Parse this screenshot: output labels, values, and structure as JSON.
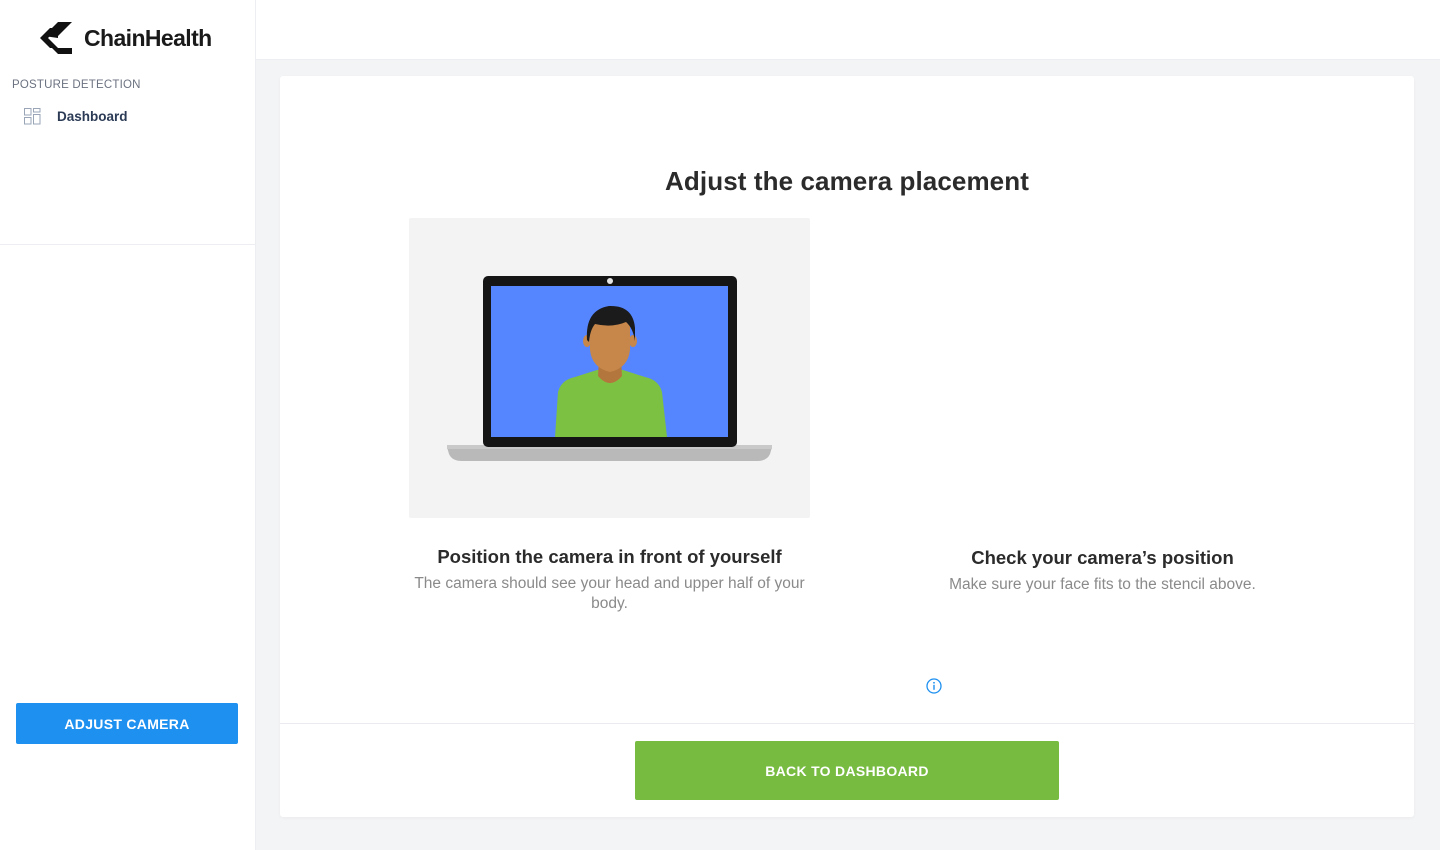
{
  "brand": {
    "name": "ChainHealth",
    "logo_icon": "chainhealth-logo-icon"
  },
  "sidebar": {
    "section_label": "POSTURE DETECTION",
    "items": [
      {
        "label": "Dashboard",
        "icon": "dashboard-grid-icon"
      }
    ],
    "adjust_camera_label": "ADJUST CAMERA"
  },
  "main": {
    "title": "Adjust the camera placement",
    "steps": [
      {
        "title": "Position the camera in front of yourself",
        "description": "The camera should see your head and upper half of your body."
      },
      {
        "title": "Check your camera’s position",
        "description": "Make sure your face fits to the stencil above."
      }
    ],
    "info_icon": "info-icon",
    "back_button_label": "BACK TO DASHBOARD"
  },
  "colors": {
    "primary_blue": "#1e90f0",
    "action_green": "#77bb41",
    "screen_blue": "#5585ff",
    "shirt_green": "#7dc142",
    "skin": "#c7874a"
  }
}
